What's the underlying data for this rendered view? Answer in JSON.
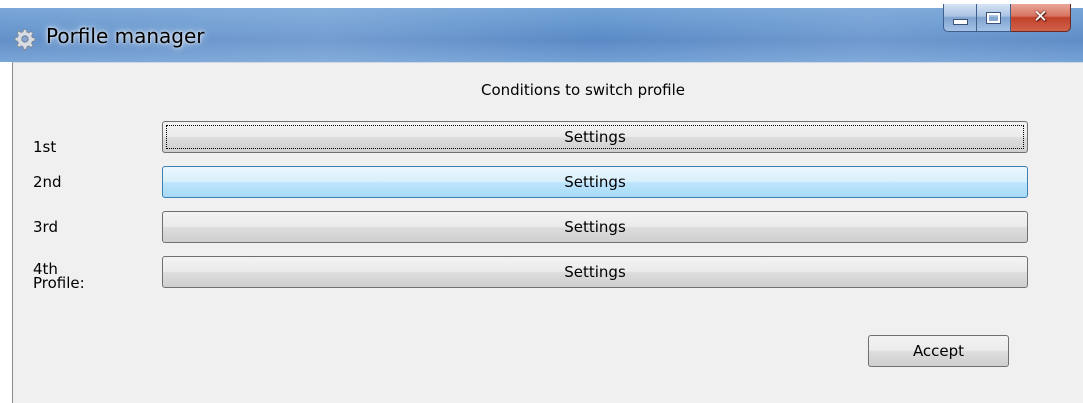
{
  "window": {
    "title": "Porfile manager",
    "icon": "gear-icon",
    "caption_buttons": {
      "minimize": "minimize-icon",
      "maximize": "maximize-icon",
      "close": "close-icon"
    }
  },
  "main": {
    "heading": "Conditions to switch profile",
    "rows": [
      {
        "label": "1st",
        "button_label": "Settings"
      },
      {
        "label": "2nd",
        "button_label": "Settings"
      },
      {
        "label": "3rd",
        "button_label": "Settings"
      },
      {
        "label_line1": "4th",
        "label_line2": "Profile:",
        "button_label": "Settings"
      }
    ],
    "accept_label": "Accept"
  },
  "colors": {
    "title_bar": "#5b8fca",
    "client_background": "#f0f0f0",
    "hover_button": "#bee6fd",
    "close_button": "#c2412a"
  }
}
